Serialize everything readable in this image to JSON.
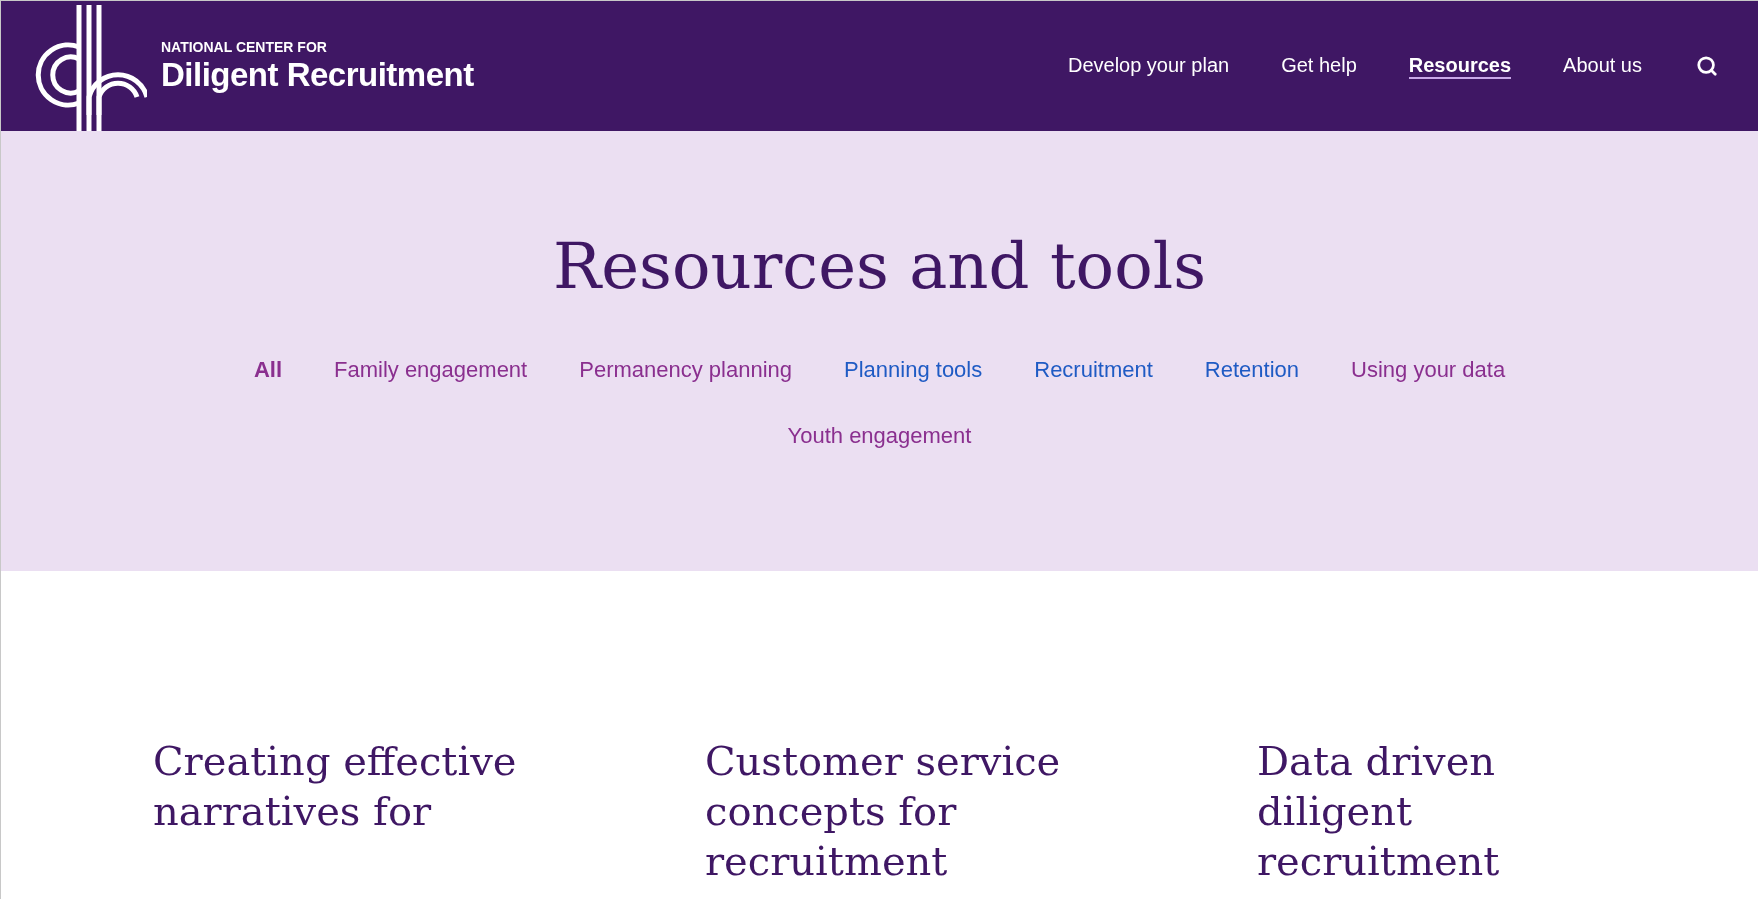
{
  "header": {
    "logo": {
      "line_1": "NATIONAL CENTER FOR",
      "line_2": "Diligent Recruitment"
    },
    "nav": [
      {
        "label": "Develop your plan",
        "selected": false
      },
      {
        "label": "Get help",
        "selected": false
      },
      {
        "label": "Resources",
        "selected": true
      },
      {
        "label": "About us",
        "selected": false
      }
    ]
  },
  "hero": {
    "title": "Resources and tools",
    "filters": [
      {
        "label": "All",
        "selected": true,
        "color": "#8a2f8f"
      },
      {
        "label": "Family engagement",
        "selected": false,
        "color": "#8a2f8f"
      },
      {
        "label": "Permanency planning",
        "selected": false,
        "color": "#8a2f8f"
      },
      {
        "label": "Planning tools",
        "selected": false,
        "color": "#1f5bc4"
      },
      {
        "label": "Recruitment",
        "selected": false,
        "color": "#1f5bc4"
      },
      {
        "label": "Retention",
        "selected": false,
        "color": "#1f5bc4"
      },
      {
        "label": "Using your data",
        "selected": false,
        "color": "#8a2f8f"
      },
      {
        "label": "Youth engagement",
        "selected": false,
        "color": "#8a2f8f"
      }
    ]
  },
  "cards": [
    {
      "title": "Creating effective narratives for"
    },
    {
      "title": "Customer service concepts for recruitment"
    },
    {
      "title": "Data driven diligent recruitment"
    }
  ]
}
